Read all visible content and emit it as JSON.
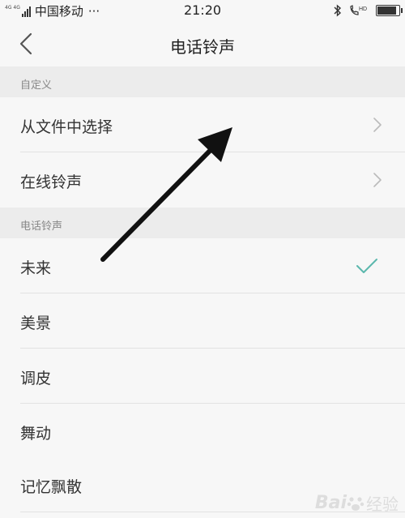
{
  "status_bar": {
    "network_tag": "4G 4G",
    "carrier": "中国移动",
    "more": "···",
    "time": "21:20",
    "battery_level_percent": 90,
    "icons": [
      "signal-icon",
      "bluetooth-icon",
      "hd-call-icon",
      "battery-icon"
    ]
  },
  "header": {
    "back_icon": "chevron-left-icon",
    "title": "电话铃声"
  },
  "sections": [
    {
      "header": "自定义",
      "items": [
        {
          "label": "从文件中选择",
          "accessory": "chevron-right-icon"
        },
        {
          "label": "在线铃声",
          "accessory": "chevron-right-icon"
        }
      ]
    },
    {
      "header": "电话铃声",
      "items": [
        {
          "label": "未来",
          "selected": true,
          "accessory": "checkmark-icon"
        },
        {
          "label": "美景",
          "selected": false
        },
        {
          "label": "调皮",
          "selected": false
        },
        {
          "label": "舞动",
          "selected": false
        },
        {
          "label": "记忆飘散",
          "selected": false
        }
      ]
    }
  ],
  "annotation": {
    "icon": "black-arrow-annotation"
  },
  "watermark": {
    "brand": "Bai",
    "text": "经验"
  },
  "colors": {
    "background": "#f7f7f7",
    "section_header_bg": "#ececec",
    "check_accent": "#5bb8ad",
    "text_primary": "#333333",
    "text_secondary": "#888888"
  }
}
